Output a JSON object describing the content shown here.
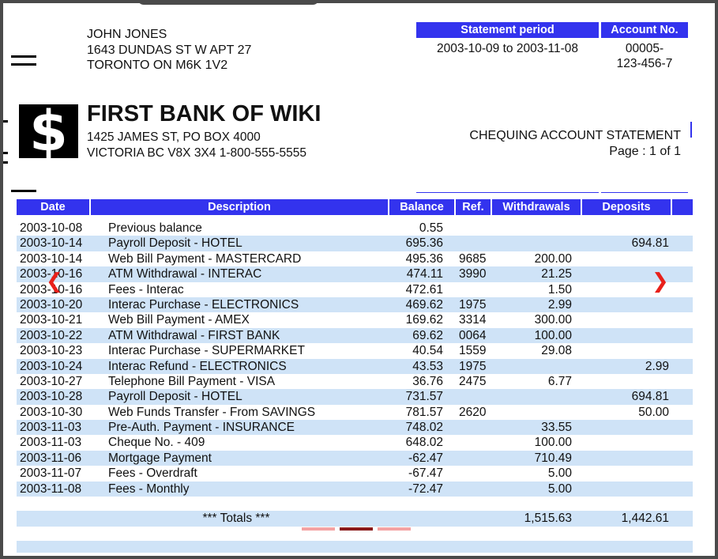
{
  "customer": {
    "name": "JOHN JONES",
    "street": "1643 DUNDAS ST W APT 27",
    "city": "TORONTO ON   M6K 1V2"
  },
  "statement_period": {
    "label": "Statement period",
    "value": "2003-10-09 to 2003-11-08"
  },
  "account": {
    "label": "Account No.",
    "value_line1": "00005-",
    "value_line2": "123-456-7"
  },
  "bank": {
    "logo_symbol": "$",
    "name": "FIRST BANK OF WIKI",
    "address_line1": "1425 JAMES ST, PO BOX 4000",
    "address_line2": "VICTORIA BC  V8X 3X4     1-800-555-5555"
  },
  "statement": {
    "title": "CHEQUING ACCOUNT STATEMENT",
    "page": "Page : 1 of 1"
  },
  "table": {
    "headers": {
      "date": "Date",
      "description": "Description",
      "balance": "Balance",
      "ref": "Ref.",
      "withdrawals": "Withdrawals",
      "deposits": "Deposits"
    },
    "rows": [
      {
        "date": "2003-10-08",
        "description": "Previous balance",
        "balance": "0.55",
        "ref": "",
        "withdrawals": "",
        "deposits": ""
      },
      {
        "date": "2003-10-14",
        "description": "Payroll Deposit - HOTEL",
        "balance": "695.36",
        "ref": "",
        "withdrawals": "",
        "deposits": "694.81"
      },
      {
        "date": "2003-10-14",
        "description": "Web Bill Payment - MASTERCARD",
        "balance": "495.36",
        "ref": "9685",
        "withdrawals": "200.00",
        "deposits": ""
      },
      {
        "date": "2003-10-16",
        "description": "ATM Withdrawal - INTERAC",
        "balance": "474.11",
        "ref": "3990",
        "withdrawals": "21.25",
        "deposits": ""
      },
      {
        "date": "2003-10-16",
        "description": "Fees - Interac",
        "balance": "472.61",
        "ref": "",
        "withdrawals": "1.50",
        "deposits": ""
      },
      {
        "date": "2003-10-20",
        "description": "Interac Purchase - ELECTRONICS",
        "balance": "469.62",
        "ref": "1975",
        "withdrawals": "2.99",
        "deposits": ""
      },
      {
        "date": "2003-10-21",
        "description": "Web Bill Payment - AMEX",
        "balance": "169.62",
        "ref": "3314",
        "withdrawals": "300.00",
        "deposits": ""
      },
      {
        "date": "2003-10-22",
        "description": "ATM Withdrawal - FIRST BANK",
        "balance": "69.62",
        "ref": "0064",
        "withdrawals": "100.00",
        "deposits": ""
      },
      {
        "date": "2003-10-23",
        "description": "Interac Purchase - SUPERMARKET",
        "balance": "40.54",
        "ref": "1559",
        "withdrawals": "29.08",
        "deposits": ""
      },
      {
        "date": "2003-10-24",
        "description": "Interac Refund - ELECTRONICS",
        "balance": "43.53",
        "ref": "1975",
        "withdrawals": "",
        "deposits": "2.99"
      },
      {
        "date": "2003-10-27",
        "description": "Telephone Bill Payment - VISA",
        "balance": "36.76",
        "ref": "2475",
        "withdrawals": "6.77",
        "deposits": ""
      },
      {
        "date": "2003-10-28",
        "description": "Payroll Deposit - HOTEL",
        "balance": "731.57",
        "ref": "",
        "withdrawals": "",
        "deposits": "694.81"
      },
      {
        "date": "2003-10-30",
        "description": "Web Funds Transfer - From  SAVINGS",
        "balance": "781.57",
        "ref": "2620",
        "withdrawals": "",
        "deposits": "50.00"
      },
      {
        "date": "2003-11-03",
        "description": "Pre-Auth. Payment - INSURANCE",
        "balance": "748.02",
        "ref": "",
        "withdrawals": "33.55",
        "deposits": ""
      },
      {
        "date": "2003-11-03",
        "description": "Cheque No. - 409",
        "balance": "648.02",
        "ref": "",
        "withdrawals": "100.00",
        "deposits": ""
      },
      {
        "date": "2003-11-06",
        "description": "Mortgage Payment",
        "balance": "-62.47",
        "ref": "",
        "withdrawals": "710.49",
        "deposits": ""
      },
      {
        "date": "2003-11-07",
        "description": "Fees - Overdraft",
        "balance": "-67.47",
        "ref": "",
        "withdrawals": "5.00",
        "deposits": ""
      },
      {
        "date": "2003-11-08",
        "description": "Fees - Monthly",
        "balance": "-72.47",
        "ref": "",
        "withdrawals": "5.00",
        "deposits": ""
      }
    ],
    "totals": {
      "label": "*** Totals ***",
      "withdrawals": "1,515.63",
      "deposits": "1,442.61"
    }
  },
  "viewer": {
    "prev_glyph": "❮",
    "next_glyph": "❯",
    "pages": 3,
    "current_page": 2,
    "icons": [
      "chevron-left-icon",
      "chevron-right-icon"
    ]
  },
  "colors": {
    "header_blue": "#3333ee",
    "row_alt": "#cfe3f7",
    "arrow_red": "#e8201a",
    "dot_active": "#8b1a1a",
    "dot_inactive": "#f4a3a3"
  }
}
